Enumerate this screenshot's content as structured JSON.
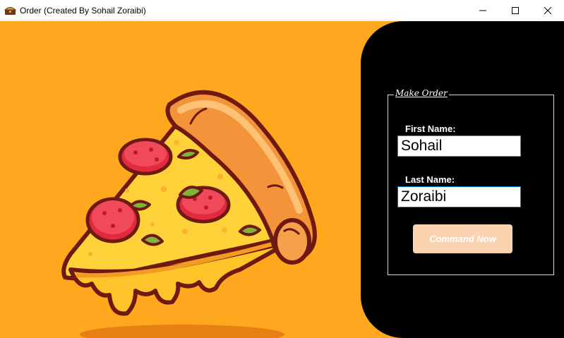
{
  "window": {
    "title": "Order (Created By Sohail Zoraibi)",
    "app_icon": "pizza-chest-icon"
  },
  "controls": {
    "minimize": "minimize-icon",
    "maximize": "maximize-icon",
    "close": "close-icon"
  },
  "form": {
    "group_title": "Make Order",
    "first_name_label": "First Name:",
    "first_name_value": "Sohail",
    "last_name_label": "Last Name:",
    "last_name_value": "Zoraibi",
    "submit_label": "Command Now"
  },
  "colors": {
    "background": "#FFA81F",
    "panel": "#000000",
    "button": "#FCD3B1"
  },
  "illustration": "pizza-slice"
}
